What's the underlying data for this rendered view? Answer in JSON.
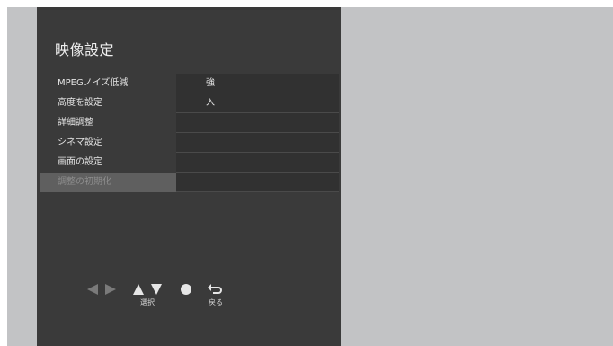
{
  "menu": {
    "title": "映像設定",
    "items": [
      {
        "label": "MPEGノイズ低減",
        "value": "強"
      },
      {
        "label": "高度を設定",
        "value": "入"
      },
      {
        "label": "詳細調整",
        "value": ""
      },
      {
        "label": "シネマ設定",
        "value": ""
      },
      {
        "label": "画面の設定",
        "value": ""
      },
      {
        "label": "調整の初期化",
        "value": ""
      }
    ]
  },
  "controls": {
    "select_label": "選択",
    "back_label": "戻る"
  },
  "colors": {
    "panel_bg": "#3a3a3a",
    "screen_bg": "#c2c3c5",
    "disabled_row_bg": "#5f5f5f"
  }
}
